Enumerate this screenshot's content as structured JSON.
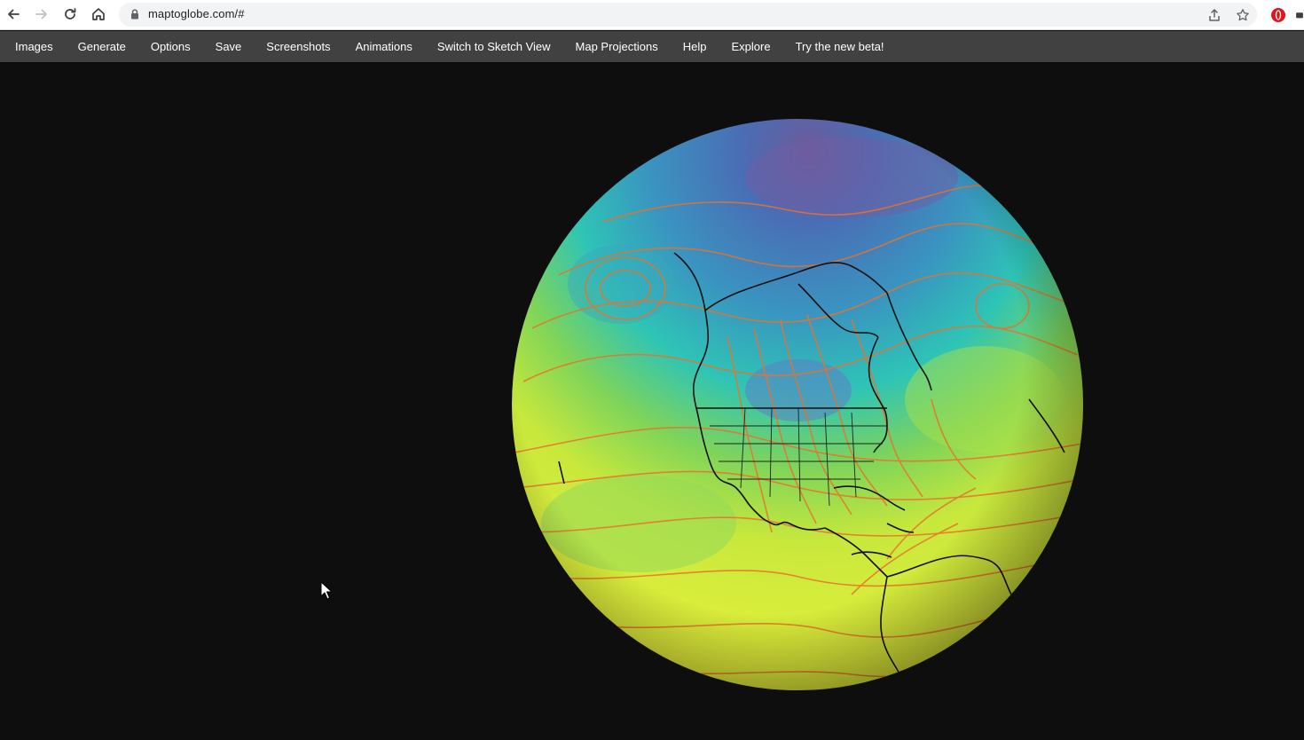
{
  "browser": {
    "url": "maptoglobe.com/#",
    "icons": {
      "back": "arrow-left-icon",
      "forward": "arrow-right-icon",
      "reload": "reload-icon",
      "home": "home-icon",
      "lock": "lock-icon",
      "share": "share-icon",
      "bookmark": "star-icon",
      "extension": "opera-extension-icon"
    }
  },
  "menu": {
    "items": [
      {
        "label": "Images"
      },
      {
        "label": "Generate"
      },
      {
        "label": "Options"
      },
      {
        "label": "Save"
      },
      {
        "label": "Screenshots"
      },
      {
        "label": "Animations"
      },
      {
        "label": "Switch to Sketch View"
      },
      {
        "label": "Map Projections"
      },
      {
        "label": "Help"
      },
      {
        "label": "Explore"
      },
      {
        "label": "Try the new beta!"
      }
    ]
  },
  "globe": {
    "visual": "3D globe centered on North America with colored weather field and contour lines",
    "colors": {
      "background": "#0e0e0e",
      "field_polar": "#3f6fb0",
      "field_mid": "#2ec4b6",
      "field_subtropic": "#9ed84a",
      "field_tropic": "#e8f03a",
      "contour": "#e8732a",
      "coastline": "#111111"
    }
  },
  "colors": {
    "menubar": "#414141",
    "menu_text": "#ffffff",
    "address_bg": "#f1f3f4"
  }
}
